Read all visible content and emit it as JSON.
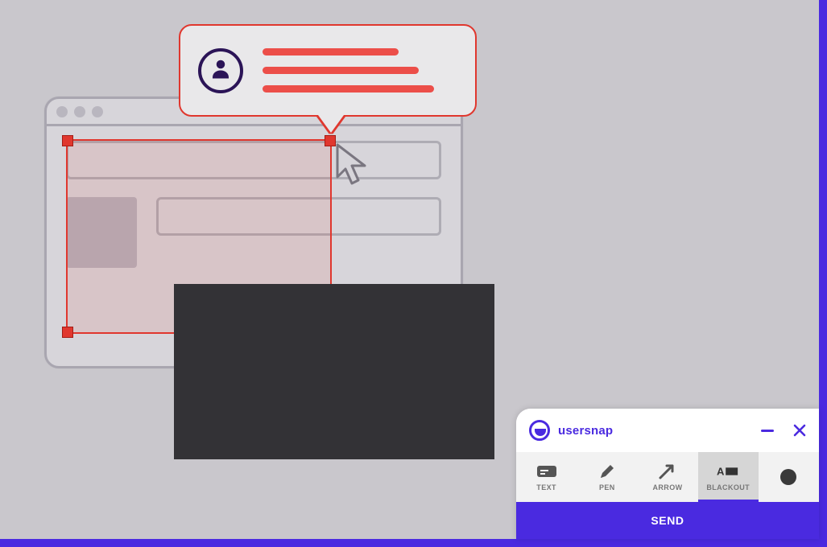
{
  "brand": {
    "name": "usersnap"
  },
  "widget": {
    "tools": [
      {
        "id": "text",
        "label": "TEXT"
      },
      {
        "id": "pen",
        "label": "PEN"
      },
      {
        "id": "arrow",
        "label": "ARROW"
      },
      {
        "id": "blackout",
        "label": "BLACKOUT"
      }
    ],
    "active_tool": "blackout",
    "send_label": "SEND"
  },
  "icons": {
    "user": "user-icon",
    "cursor": "cursor-icon",
    "minimize": "minimize-icon",
    "close": "close-icon",
    "text_tool": "text-tool-icon",
    "pen_tool": "pen-tool-icon",
    "arrow_tool": "arrow-tool-icon",
    "blackout_tool": "blackout-tool-icon",
    "color_picker": "color-picker-icon"
  },
  "colors": {
    "accent": "#4a2ae0",
    "selection": "#e0372e",
    "blackout": "#333236"
  }
}
